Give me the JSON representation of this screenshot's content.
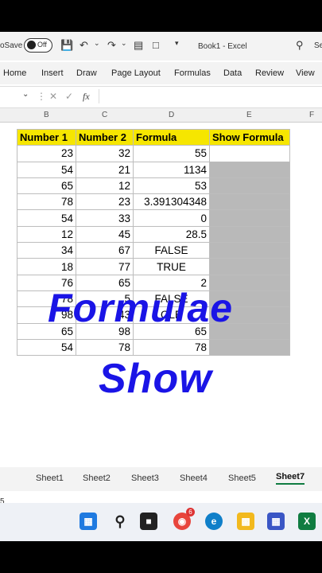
{
  "titlebar": {
    "autosave_label": "oSave",
    "toggle_label": "Off",
    "book_title": "Book1 - Excel",
    "search_label": "Se"
  },
  "ribbon_tabs": [
    "Home",
    "Insert",
    "Draw",
    "Page Layout",
    "Formulas",
    "Data",
    "Review",
    "View"
  ],
  "formula_bar": {
    "fx": "fx"
  },
  "columns": [
    "B",
    "C",
    "D",
    "E",
    "F"
  ],
  "headers": [
    "Number 1",
    "Number 2",
    "Formula",
    "Show Formula"
  ],
  "rows": [
    {
      "a": "23",
      "b": "32",
      "f": "55"
    },
    {
      "a": "54",
      "b": "21",
      "f": "1134"
    },
    {
      "a": "65",
      "b": "12",
      "f": "53"
    },
    {
      "a": "78",
      "b": "23",
      "f": "3.391304348"
    },
    {
      "a": "54",
      "b": "33",
      "f": "0"
    },
    {
      "a": "12",
      "b": "45",
      "f": "28.5"
    },
    {
      "a": "34",
      "b": "67",
      "f": "FALSE"
    },
    {
      "a": "18",
      "b": "77",
      "f": "TRUE"
    },
    {
      "a": "76",
      "b": "65",
      "f": "2"
    },
    {
      "a": "78",
      "b": "5",
      "f": "FALSE"
    },
    {
      "a": "98",
      "b": "43",
      "f": "OLE"
    },
    {
      "a": "65",
      "b": "98",
      "f": "65"
    },
    {
      "a": "54",
      "b": "78",
      "f": "78"
    }
  ],
  "overlay": {
    "line1": "Formulae",
    "line2": "Show"
  },
  "sheets": [
    "Sheet1",
    "Sheet2",
    "Sheet3",
    "Sheet4",
    "Sheet5",
    "Sheet7"
  ],
  "left_edge_label": "5",
  "taskbar": {
    "chrome_badge": "6"
  },
  "colors": {
    "header_fill": "#f6e600",
    "overlay_text": "#1a14e6",
    "selected_fill": "#b9b9b9"
  }
}
